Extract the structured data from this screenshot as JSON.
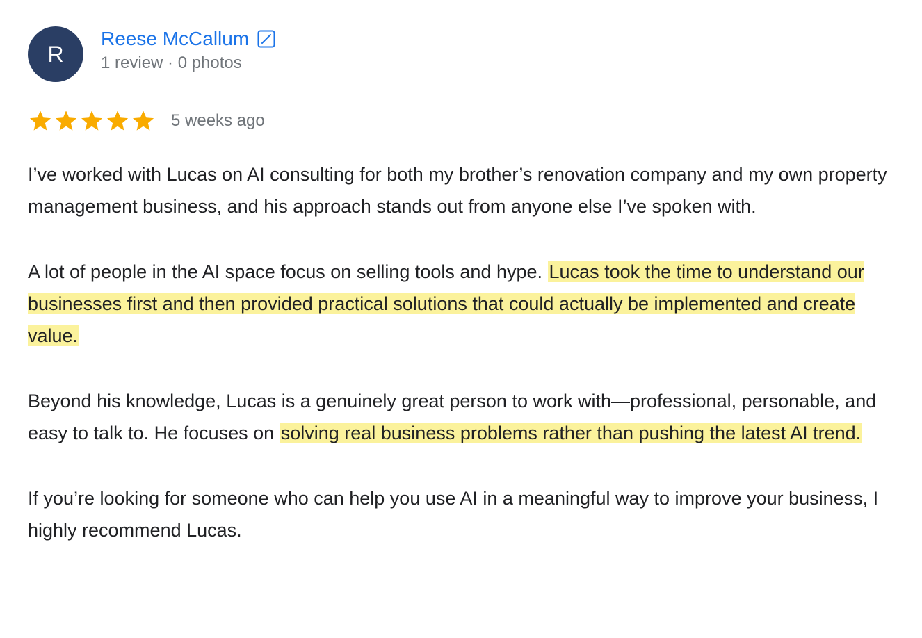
{
  "reviewer": {
    "avatar_letter": "R",
    "avatar_color": "#2a3e64",
    "name": "Reese McCallum",
    "name_color": "#1a73e8",
    "name_icon": "edit-external-icon",
    "meta": "1 review · 0 photos"
  },
  "rating": {
    "stars": 5,
    "max_stars": 5,
    "star_color": "#f9ab00",
    "date": "5 weeks ago"
  },
  "highlight_color": "#fbf29c",
  "body": {
    "p1": "I’ve worked with Lucas on AI consulting for both my brother’s renovation company and my own property management business, and his approach stands out from anyone else I’ve spoken with.",
    "p2_before": "A lot of people in the AI space focus on selling tools and hype. ",
    "p2_highlight": "Lucas took the time to understand our businesses first and then provided practical solutions that could actually be implemented and create value.",
    "p3_before": "Beyond his knowledge, Lucas is a genuinely great person to work with—professional, personable, and easy to talk to. He focuses on ",
    "p3_highlight": "solving real business problems rather than pushing the latest AI trend.",
    "p4": "If you’re looking for someone who can help you use AI in a meaningful way to improve your business, I highly recommend Lucas."
  }
}
